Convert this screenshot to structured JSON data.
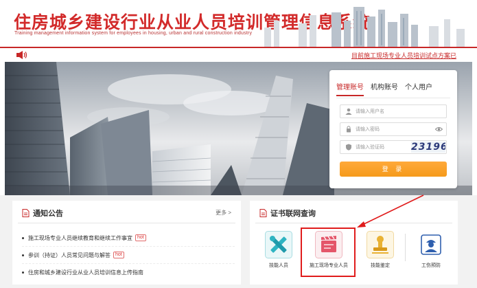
{
  "header": {
    "title": "住房城乡建设行业从业人员培训管理信息系统",
    "subtitle": "Training management information system for employees in housing, urban and rural construction industry"
  },
  "notice_bar": {
    "icon": "speaker-icon",
    "link_text": "目前施工现场专业人员培训试点方案已"
  },
  "login": {
    "tabs": [
      {
        "label": "管理账号",
        "active": true
      },
      {
        "label": "机构账号",
        "active": false
      },
      {
        "label": "个人用户",
        "active": false
      }
    ],
    "username_placeholder": "请输入用户名",
    "password_placeholder": "请输入密码",
    "captcha_placeholder": "请输入验证码",
    "captcha_value": "23196",
    "submit_label": "登 录"
  },
  "notices": {
    "title": "通知公告",
    "more_label": "更多 >",
    "items": [
      {
        "text": "施工现场专业人员继续教育和继续工作事宜",
        "hot": "hot"
      },
      {
        "text": "参训（持证）人员常见问题与解答",
        "hot": "hot"
      },
      {
        "text": "住房和城乡建设行业从业人员培训信息上传指南",
        "hot": ""
      }
    ]
  },
  "certificates": {
    "title": "证书联网查询",
    "tiles": [
      {
        "label": "技能人员",
        "icon": "tools-icon"
      },
      {
        "label": "施工现场专业人员",
        "icon": "clapperboard-icon"
      },
      {
        "label": "技能鉴定",
        "icon": "stamp-icon"
      },
      {
        "label": "工伤预防",
        "icon": "worker-icon"
      }
    ]
  },
  "colors": {
    "brand_red": "#c72727",
    "login_orange": "#f59a1b",
    "highlight_red": "#e01b1b"
  }
}
